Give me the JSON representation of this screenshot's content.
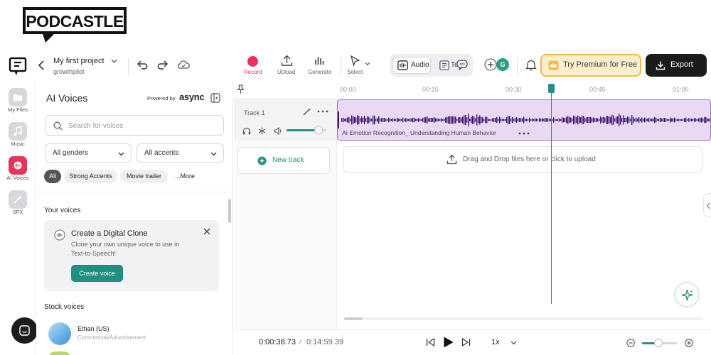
{
  "brand": {
    "logo_text": "PODCASTLE"
  },
  "header": {
    "project_title": "My first project",
    "project_subtitle": "growthpilot",
    "tools": [
      {
        "label": "Record",
        "icon": "record-icon"
      },
      {
        "label": "Upload",
        "icon": "upload-icon"
      },
      {
        "label": "Generate",
        "icon": "generate-icon"
      },
      {
        "label": "Select",
        "icon": "select-cursor-icon"
      }
    ],
    "mode_tabs": [
      {
        "label": "Audio",
        "active": true
      },
      {
        "label": "Text",
        "active": false
      }
    ],
    "collaborator_initial": "G",
    "premium_label": "Try Premium for Free",
    "export_label": "Export"
  },
  "rail": {
    "items": [
      {
        "label": "My Files",
        "icon": "folder-icon"
      },
      {
        "label": "Music",
        "icon": "music-note-icon"
      },
      {
        "label": "AI Voices",
        "icon": "ai-voice-icon",
        "active": true
      },
      {
        "label": "SFX",
        "icon": "sfx-icon"
      }
    ]
  },
  "panel": {
    "title": "AI Voices",
    "powered_by": "Powered by",
    "powered_brand": "async",
    "search_placeholder": "Search for voices",
    "gender_select": "All genders",
    "accent_select": "All accents",
    "chips": [
      "All",
      "Strong Accents",
      "Movie trailer",
      "...More"
    ],
    "your_voices_label": "Your voices",
    "clone_card": {
      "title": "Create a Digital Clone",
      "description": "Clone your own unique voice to use in Text-to-Speech!",
      "button_label": "Create voice"
    },
    "stock_voices_label": "Stock voices",
    "stock_voices": [
      {
        "name": "Ethan (US)",
        "tags": "Commercial/Advertisement"
      }
    ]
  },
  "timeline": {
    "ticks": [
      "00:00",
      "00:15",
      "00:30",
      "00:45",
      "01:00"
    ],
    "track_name": "Track 1",
    "track_volume": 0.8,
    "clip_title": "AI Emotion Recognition_ Understanding Human Behavior",
    "new_track_label": "New track",
    "drop_text": "Drag and Drop files here or click to upload"
  },
  "transport": {
    "current_time": "0:00:38.73",
    "separator": "/",
    "total_time": "0:14:59.39",
    "speed": "1x",
    "zoom_level": 0.45
  },
  "colors": {
    "accent": "#1f8f82",
    "record": "#e8345a",
    "clip_bg": "#e9d9f2",
    "waveform": "#3e1670",
    "premium_border": "#f2b949"
  }
}
